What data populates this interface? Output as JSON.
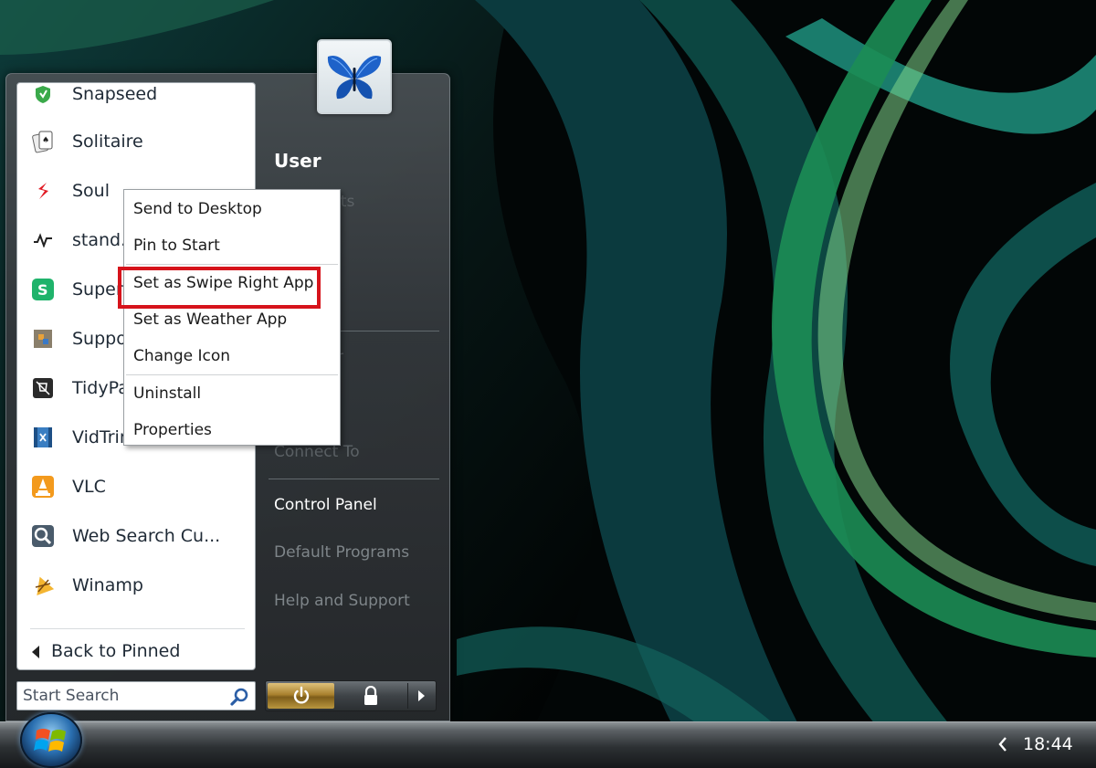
{
  "programs": [
    {
      "label": "Snapseed",
      "icon": "snapseed-icon"
    },
    {
      "label": "Solitaire",
      "icon": "solitaire-icon"
    },
    {
      "label": "Soul",
      "icon": "soul-icon"
    },
    {
      "label": "stand.f",
      "icon": "stand-icon"
    },
    {
      "label": "Super",
      "icon": "super-icon"
    },
    {
      "label": "Suppo",
      "icon": "support-icon"
    },
    {
      "label": "TidyPa",
      "icon": "tidypanel-icon"
    },
    {
      "label": "VidTrim",
      "icon": "vidtrim-icon"
    },
    {
      "label": "VLC",
      "icon": "vlc-icon"
    },
    {
      "label": "Web Search Cu...",
      "icon": "web-search-icon"
    },
    {
      "label": "Winamp",
      "icon": "winamp-icon"
    }
  ],
  "back_label": "Back to Pinned",
  "search": {
    "placeholder": "Start Search"
  },
  "right_column": {
    "user": "User",
    "documents": "nts",
    "computer": "r",
    "connect_to": "Connect To",
    "control_panel": "Control Panel",
    "default_programs": "Default Programs",
    "help": "Help and Support"
  },
  "context_menu": {
    "items": [
      "Send to Desktop",
      "Pin to Start",
      "Set as Swipe Right App",
      "Set as Weather App",
      "Change Icon",
      "Uninstall",
      "Properties"
    ],
    "highlighted": "Set as Swipe Right App",
    "highlight_color": "#d6131b"
  },
  "taskbar": {
    "clock": "18:44"
  },
  "colors": {
    "accent": "#1f8f86",
    "menu_bg": "#3e4347"
  }
}
